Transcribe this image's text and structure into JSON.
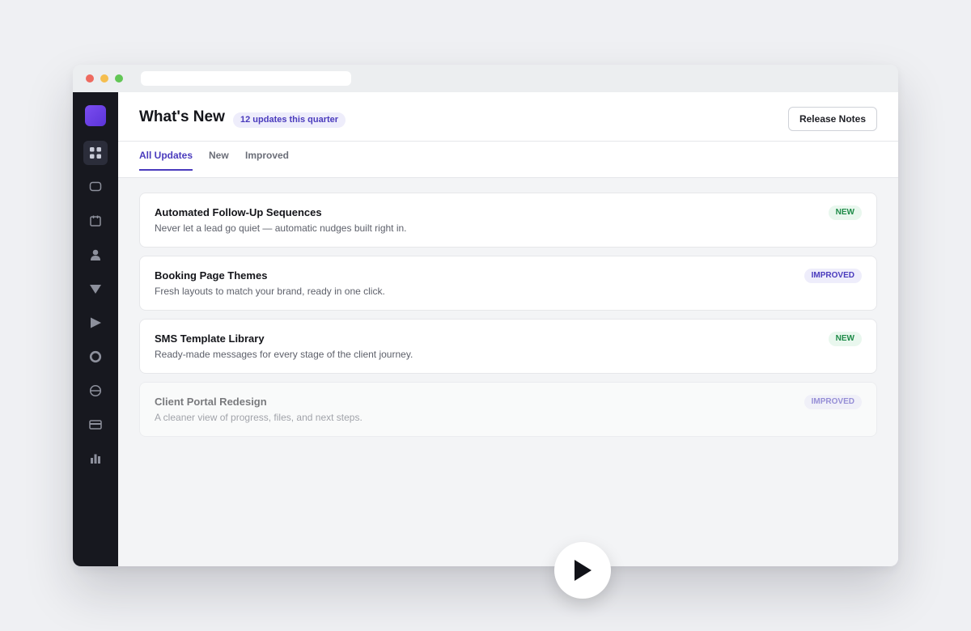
{
  "window": {
    "traffic_lights": [
      "#ee6a5f",
      "#f5be4f",
      "#62c655"
    ]
  },
  "sidebar": {
    "items": [
      {
        "icon": "grid-icon",
        "active": true
      },
      {
        "icon": "chat-bubble-icon",
        "active": false
      },
      {
        "icon": "calendar-icon",
        "active": false
      },
      {
        "icon": "person-icon",
        "active": false
      },
      {
        "icon": "filter-funnel-icon",
        "active": false
      },
      {
        "icon": "send-arrow-icon",
        "active": false
      },
      {
        "icon": "ring-icon",
        "active": false
      },
      {
        "icon": "globe-icon",
        "active": false
      },
      {
        "icon": "credit-card-icon",
        "active": false
      },
      {
        "icon": "bar-chart-icon",
        "active": false
      }
    ]
  },
  "header": {
    "title": "What's New",
    "badge": "12 updates this quarter",
    "release_notes_label": "Release Notes"
  },
  "tabs": [
    {
      "label": "All Updates",
      "active": true
    },
    {
      "label": "New",
      "active": false
    },
    {
      "label": "Improved",
      "active": false
    }
  ],
  "updates": [
    {
      "title": "Automated Follow-Up Sequences",
      "description": "Never let a lead go quiet — automatic nudges built right in.",
      "tag": "NEW"
    },
    {
      "title": "Booking Page Themes",
      "description": "Fresh layouts to match your brand, ready in one click.",
      "tag": "IMPROVED"
    },
    {
      "title": "SMS Template Library",
      "description": "Ready-made messages for every stage of the client journey.",
      "tag": "NEW"
    },
    {
      "title": "Client Portal Redesign",
      "description": "A cleaner view of progress, files, and next steps.",
      "tag": "IMPROVED"
    }
  ],
  "colors": {
    "accent": "#4a3bbd",
    "sidebar_bg": "#17181f",
    "new_tag": "#1d8a47",
    "improved_tag": "#4a3bbd"
  },
  "overlay": {
    "icon": "play-icon"
  }
}
